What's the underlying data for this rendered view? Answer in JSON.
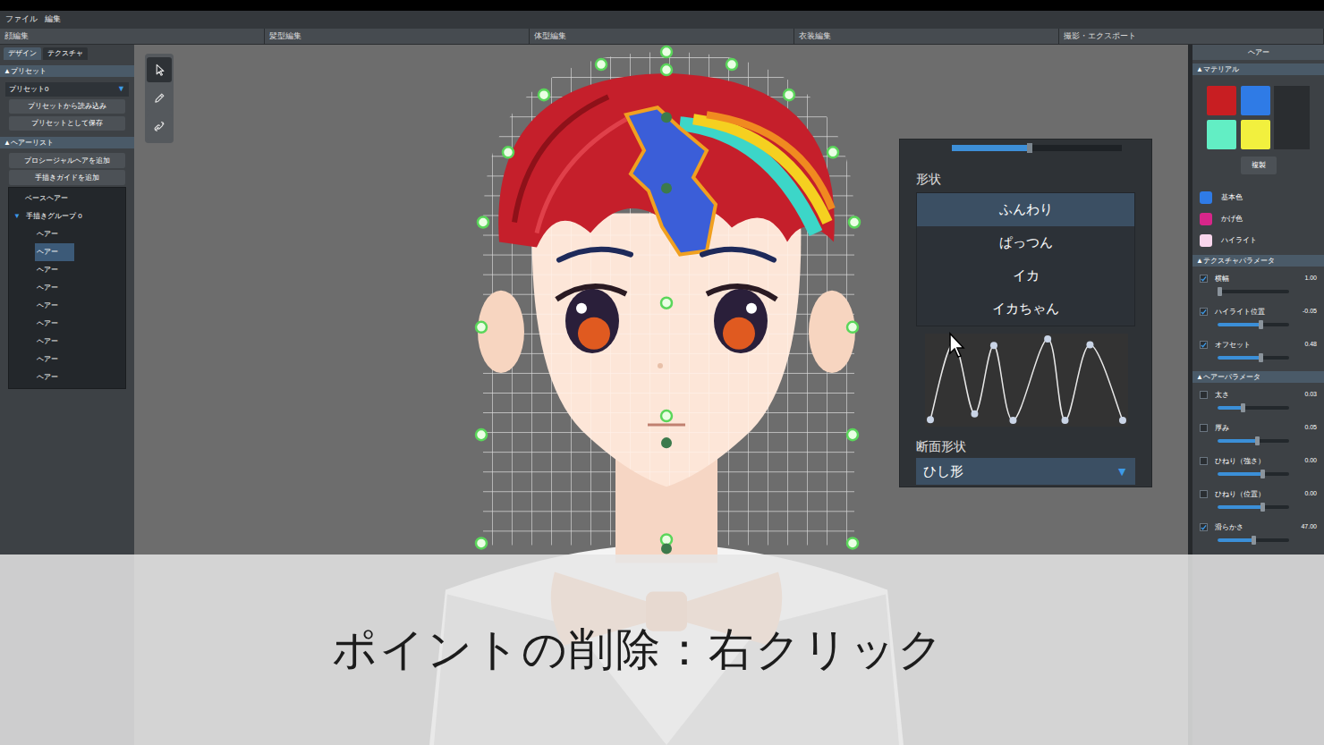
{
  "menu": [
    "ファイル",
    "編集"
  ],
  "mode_tabs": [
    {
      "label": "顔編集",
      "selected": false
    },
    {
      "label": "髪型編集",
      "selected": false
    },
    {
      "label": "体型編集",
      "selected": false
    },
    {
      "label": "衣装編集",
      "selected": false
    },
    {
      "label": "撮影・エクスポート",
      "selected": false
    }
  ],
  "left_panel": {
    "tabs": [
      {
        "label": "デザイン",
        "selected": true
      },
      {
        "label": "テクスチャ",
        "selected": false
      }
    ],
    "preset": {
      "header": "▲プリセット",
      "dropdown": "プリセット0",
      "arrow": "▼",
      "buttons": [
        "プリセットから読み込み",
        "プリセットとして保存"
      ]
    },
    "hair_list": {
      "header": "▲ヘアーリスト",
      "buttons": [
        "プロシージャルヘアを追加",
        "手描きガイドを追加"
      ],
      "tree": [
        {
          "label": "ベースヘアー",
          "kind": "base",
          "selected": false
        },
        {
          "label": "手描きグループ 0",
          "kind": "group",
          "toggle": "▼",
          "expanded": true,
          "selected": false
        },
        {
          "label": "ヘアー",
          "kind": "hair",
          "selected": false
        },
        {
          "label": "ヘアー",
          "kind": "hair",
          "selected": true
        },
        {
          "label": "ヘアー",
          "kind": "hair",
          "selected": false
        },
        {
          "label": "ヘアー",
          "kind": "hair",
          "selected": false
        },
        {
          "label": "ヘアー",
          "kind": "hair",
          "selected": false
        },
        {
          "label": "ヘアー",
          "kind": "hair",
          "selected": false
        },
        {
          "label": "ヘアー",
          "kind": "hair",
          "selected": false
        },
        {
          "label": "ヘアー",
          "kind": "hair",
          "selected": false
        },
        {
          "label": "ヘアー",
          "kind": "hair",
          "selected": false
        }
      ]
    }
  },
  "tools": [
    {
      "kind": "select",
      "selected": true
    },
    {
      "kind": "pencil",
      "selected": false
    },
    {
      "kind": "link",
      "selected": false
    }
  ],
  "shape_panel": {
    "slider_level": 0.46,
    "title": "形状",
    "options": [
      {
        "label": "ふんわり",
        "selected": true
      },
      {
        "label": "ぱっつん",
        "selected": false
      },
      {
        "label": "イカ",
        "selected": false
      },
      {
        "label": "イカちゃん",
        "selected": false
      }
    ],
    "curve": {
      "points": [
        {
          "x": 0,
          "y": 0.02
        },
        {
          "x": 0.12,
          "y": 0.95
        },
        {
          "x": 0.23,
          "y": 0.09
        },
        {
          "x": 0.33,
          "y": 0.92
        },
        {
          "x": 0.43,
          "y": 0.01
        },
        {
          "x": 0.61,
          "y": 1.0
        },
        {
          "x": 0.7,
          "y": 0.01
        },
        {
          "x": 0.83,
          "y": 0.93
        },
        {
          "x": 1,
          "y": 0.01
        }
      ]
    },
    "section_title": "断面形状",
    "dropdown": "ひし形",
    "arrow": "▼"
  },
  "right_panel": {
    "title": "ヘアー",
    "material": {
      "header": "▲マテリアル",
      "swatches": [
        {
          "color": "#c81e22"
        },
        {
          "color": "#2f7be6"
        },
        {
          "color": "#62eec4"
        },
        {
          "color": "#f2f03e"
        }
      ],
      "copy_button": "複製",
      "legend": [
        {
          "label": "基本色",
          "color": "#2f7be6"
        },
        {
          "label": "かげ色",
          "color": "#d8268a"
        },
        {
          "label": "ハイライト",
          "color": "#f8d6ec"
        }
      ]
    },
    "texture_params": {
      "header": "▲テクスチャパラメータ",
      "rows": [
        {
          "label": "横幅",
          "value": "1.00",
          "checked": true,
          "level": 0.03
        },
        {
          "label": "ハイライト位置",
          "value": "-0.05",
          "checked": true,
          "level": 0.6
        },
        {
          "label": "オフセット",
          "value": "0.48",
          "checked": true,
          "level": 0.6
        }
      ]
    },
    "hair_params": {
      "header": "▲ヘアーパラメータ",
      "rows": [
        {
          "label": "太さ",
          "value": "0.03",
          "checked": false,
          "level": 0.35
        },
        {
          "label": "厚み",
          "value": "0.05",
          "checked": false,
          "level": 0.55
        },
        {
          "label": "ひねり（強さ）",
          "value": "0.00",
          "checked": false,
          "level": 0.62
        },
        {
          "label": "ひねり（位置）",
          "value": "0.00",
          "checked": false,
          "level": 0.62
        },
        {
          "label": "滑らかさ",
          "value": "47.00",
          "checked": true,
          "level": 0.5
        }
      ]
    }
  },
  "caption": "ポイントの削除：右クリック"
}
